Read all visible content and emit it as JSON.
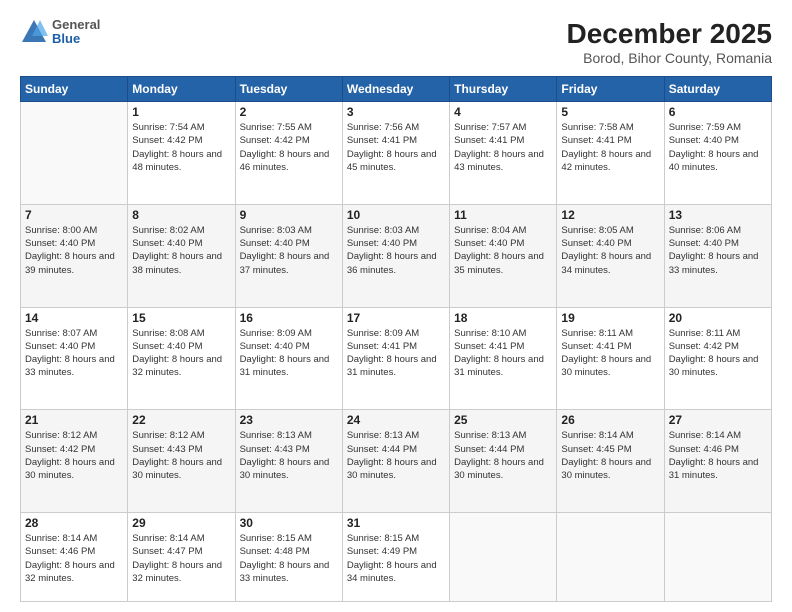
{
  "header": {
    "logo": {
      "general": "General",
      "blue": "Blue"
    },
    "title": "December 2025",
    "subtitle": "Borod, Bihor County, Romania"
  },
  "calendar": {
    "weekdays": [
      "Sunday",
      "Monday",
      "Tuesday",
      "Wednesday",
      "Thursday",
      "Friday",
      "Saturday"
    ],
    "weeks": [
      [
        {
          "day": "",
          "empty": true
        },
        {
          "day": "1",
          "sunrise": "7:54 AM",
          "sunset": "4:42 PM",
          "daylight": "8 hours and 48 minutes."
        },
        {
          "day": "2",
          "sunrise": "7:55 AM",
          "sunset": "4:42 PM",
          "daylight": "8 hours and 46 minutes."
        },
        {
          "day": "3",
          "sunrise": "7:56 AM",
          "sunset": "4:41 PM",
          "daylight": "8 hours and 45 minutes."
        },
        {
          "day": "4",
          "sunrise": "7:57 AM",
          "sunset": "4:41 PM",
          "daylight": "8 hours and 43 minutes."
        },
        {
          "day": "5",
          "sunrise": "7:58 AM",
          "sunset": "4:41 PM",
          "daylight": "8 hours and 42 minutes."
        },
        {
          "day": "6",
          "sunrise": "7:59 AM",
          "sunset": "4:40 PM",
          "daylight": "8 hours and 40 minutes."
        }
      ],
      [
        {
          "day": "7",
          "sunrise": "8:00 AM",
          "sunset": "4:40 PM",
          "daylight": "8 hours and 39 minutes."
        },
        {
          "day": "8",
          "sunrise": "8:02 AM",
          "sunset": "4:40 PM",
          "daylight": "8 hours and 38 minutes."
        },
        {
          "day": "9",
          "sunrise": "8:03 AM",
          "sunset": "4:40 PM",
          "daylight": "8 hours and 37 minutes."
        },
        {
          "day": "10",
          "sunrise": "8:03 AM",
          "sunset": "4:40 PM",
          "daylight": "8 hours and 36 minutes."
        },
        {
          "day": "11",
          "sunrise": "8:04 AM",
          "sunset": "4:40 PM",
          "daylight": "8 hours and 35 minutes."
        },
        {
          "day": "12",
          "sunrise": "8:05 AM",
          "sunset": "4:40 PM",
          "daylight": "8 hours and 34 minutes."
        },
        {
          "day": "13",
          "sunrise": "8:06 AM",
          "sunset": "4:40 PM",
          "daylight": "8 hours and 33 minutes."
        }
      ],
      [
        {
          "day": "14",
          "sunrise": "8:07 AM",
          "sunset": "4:40 PM",
          "daylight": "8 hours and 33 minutes."
        },
        {
          "day": "15",
          "sunrise": "8:08 AM",
          "sunset": "4:40 PM",
          "daylight": "8 hours and 32 minutes."
        },
        {
          "day": "16",
          "sunrise": "8:09 AM",
          "sunset": "4:40 PM",
          "daylight": "8 hours and 31 minutes."
        },
        {
          "day": "17",
          "sunrise": "8:09 AM",
          "sunset": "4:41 PM",
          "daylight": "8 hours and 31 minutes."
        },
        {
          "day": "18",
          "sunrise": "8:10 AM",
          "sunset": "4:41 PM",
          "daylight": "8 hours and 31 minutes."
        },
        {
          "day": "19",
          "sunrise": "8:11 AM",
          "sunset": "4:41 PM",
          "daylight": "8 hours and 30 minutes."
        },
        {
          "day": "20",
          "sunrise": "8:11 AM",
          "sunset": "4:42 PM",
          "daylight": "8 hours and 30 minutes."
        }
      ],
      [
        {
          "day": "21",
          "sunrise": "8:12 AM",
          "sunset": "4:42 PM",
          "daylight": "8 hours and 30 minutes."
        },
        {
          "day": "22",
          "sunrise": "8:12 AM",
          "sunset": "4:43 PM",
          "daylight": "8 hours and 30 minutes."
        },
        {
          "day": "23",
          "sunrise": "8:13 AM",
          "sunset": "4:43 PM",
          "daylight": "8 hours and 30 minutes."
        },
        {
          "day": "24",
          "sunrise": "8:13 AM",
          "sunset": "4:44 PM",
          "daylight": "8 hours and 30 minutes."
        },
        {
          "day": "25",
          "sunrise": "8:13 AM",
          "sunset": "4:44 PM",
          "daylight": "8 hours and 30 minutes."
        },
        {
          "day": "26",
          "sunrise": "8:14 AM",
          "sunset": "4:45 PM",
          "daylight": "8 hours and 30 minutes."
        },
        {
          "day": "27",
          "sunrise": "8:14 AM",
          "sunset": "4:46 PM",
          "daylight": "8 hours and 31 minutes."
        }
      ],
      [
        {
          "day": "28",
          "sunrise": "8:14 AM",
          "sunset": "4:46 PM",
          "daylight": "8 hours and 32 minutes."
        },
        {
          "day": "29",
          "sunrise": "8:14 AM",
          "sunset": "4:47 PM",
          "daylight": "8 hours and 32 minutes."
        },
        {
          "day": "30",
          "sunrise": "8:15 AM",
          "sunset": "4:48 PM",
          "daylight": "8 hours and 33 minutes."
        },
        {
          "day": "31",
          "sunrise": "8:15 AM",
          "sunset": "4:49 PM",
          "daylight": "8 hours and 34 minutes."
        },
        {
          "day": "",
          "empty": true
        },
        {
          "day": "",
          "empty": true
        },
        {
          "day": "",
          "empty": true
        }
      ]
    ]
  }
}
